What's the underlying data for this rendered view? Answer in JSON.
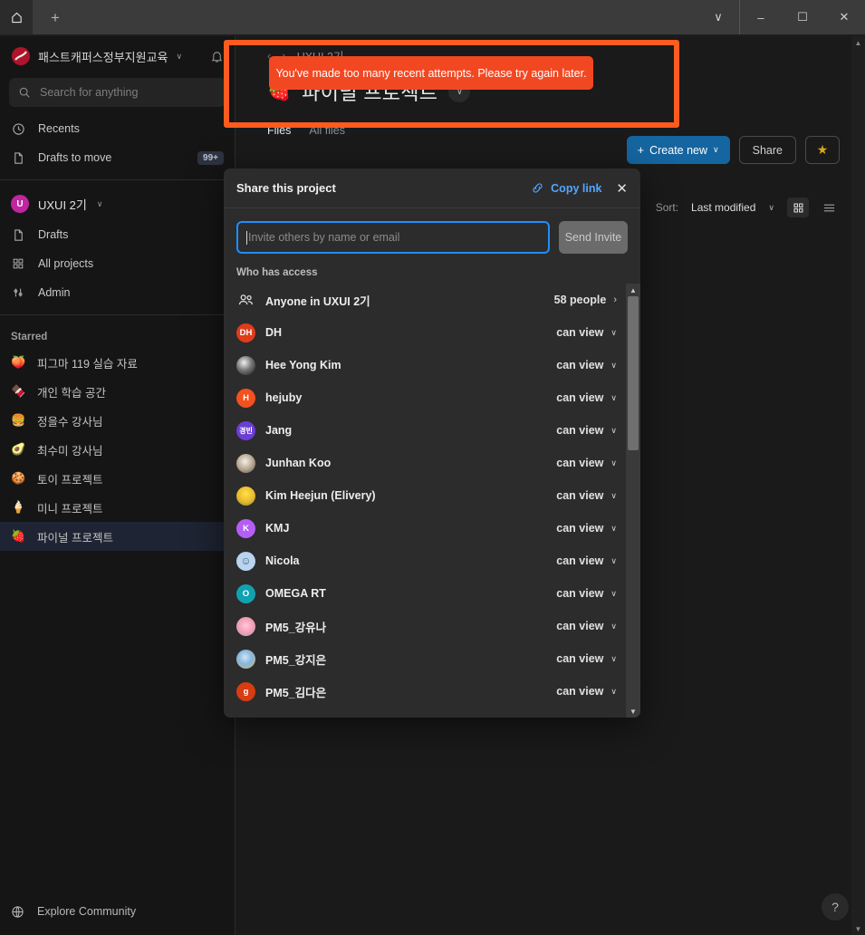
{
  "browser": {
    "home_icon": "home-icon",
    "new_tab_label": "+",
    "minimize_label": "–",
    "maximize_label": "☐",
    "close_label": "✕",
    "tab_list_label": "∨"
  },
  "sidebar": {
    "org_name": "패스트캐퍼스정부지원교육",
    "org_caret": "∨",
    "search": {
      "placeholder": "Search for anything"
    },
    "nav": [
      {
        "label": "Recents",
        "icon": "clock-icon",
        "badge": ""
      },
      {
        "label": "Drafts to move",
        "icon": "file-icon",
        "badge": "99+"
      }
    ],
    "team": {
      "name": "UXUI 2기",
      "initial": "U",
      "caret": "∨"
    },
    "team_nav": [
      {
        "label": "Drafts",
        "icon": "file-icon"
      },
      {
        "label": "All projects",
        "icon": "grid-icon"
      },
      {
        "label": "Admin",
        "icon": "sliders-icon"
      }
    ],
    "starred_label": "Starred",
    "starred": [
      {
        "emoji": "🍑",
        "label": "피그마 119 실습 자료",
        "active": false
      },
      {
        "emoji": "🍫",
        "label": "개인 학습 공간",
        "active": false
      },
      {
        "emoji": "🍔",
        "label": "정을수 강사님",
        "active": false
      },
      {
        "emoji": "🥑",
        "label": "최수미 강사님",
        "active": false
      },
      {
        "emoji": "🍪",
        "label": "토이 프로젝트",
        "active": false
      },
      {
        "emoji": "🍦",
        "label": "미니 프로젝트",
        "active": false
      },
      {
        "emoji": "🍓",
        "label": "파이널 프로젝트",
        "active": true
      }
    ],
    "explore": {
      "label": "Explore Community",
      "icon": "globe-icon"
    }
  },
  "main": {
    "breadcrumb": {
      "back": "‹",
      "forward": "›",
      "label": "UXUI 2기"
    },
    "project": {
      "emoji": "🍓",
      "title": "파이널 프로젝트",
      "caret": "∨"
    },
    "actions": {
      "create_new": "Create new",
      "create_plus": "+",
      "create_caret": "∨",
      "share": "Share",
      "star": "★"
    },
    "tabs": [
      {
        "label": "Files",
        "active": true
      },
      {
        "label": "All files",
        "active": false
      }
    ],
    "sort": {
      "label": "Sort:",
      "value": "Last modified",
      "caret": "∨"
    },
    "view": {
      "grid_icon": "grid-view-icon",
      "list_icon": "list-view-icon"
    },
    "help_button": "?"
  },
  "toast": {
    "message": "You've made too many recent attempts. Please try again later.",
    "bg_color": "#f24822",
    "highlight_color": "#ff5b1f"
  },
  "dialog": {
    "title": "Share this project",
    "copy_link": "Copy link",
    "copy_link_icon": "link-icon",
    "close_icon": "✕",
    "invite": {
      "placeholder": "Invite others by name or email",
      "value": "",
      "send_button": "Send Invite"
    },
    "who_has_access_label": "Who has access",
    "anyone_row": {
      "icon": "people-icon",
      "label": "Anyone in UXUI 2기",
      "count": "58 people",
      "chevron": "›"
    },
    "permission_default": "can view",
    "permission_caret": "∨",
    "members": [
      {
        "name": "DH",
        "initial": "DH",
        "avatar_color": "#e03c1a",
        "photo": false
      },
      {
        "name": "Hee Yong Kim",
        "initial": "",
        "avatar_color": "#8a8a8a",
        "photo": true,
        "perm": "can view"
      },
      {
        "name": "hejuby",
        "initial": "H",
        "avatar_color": "#f4511e",
        "photo": false,
        "perm": "can view"
      },
      {
        "name": "Jang",
        "initial": "경빈",
        "avatar_color": "#6b3fd4",
        "photo": false,
        "perm": "can view"
      },
      {
        "name": "Junhan Koo",
        "initial": "",
        "avatar_color": "#9e9287",
        "photo": true,
        "perm": "can view"
      },
      {
        "name": "Kim Heejun (Elivery)",
        "initial": "",
        "avatar_color": "#d9c24a",
        "photo": true,
        "perm": "can view"
      },
      {
        "name": "KMJ",
        "initial": "K",
        "avatar_color": "#b45ef7",
        "photo": false,
        "perm": "can view"
      },
      {
        "name": "Nicola",
        "initial": "☺",
        "avatar_color": "#b8d4ef",
        "photo": false,
        "perm": "can view"
      },
      {
        "name": "OMEGA RT",
        "initial": "O",
        "avatar_color": "#11a2b0",
        "photo": false,
        "perm": "can view"
      },
      {
        "name": "PM5_강유나",
        "initial": "",
        "avatar_color": "#e8a7bd",
        "photo": true,
        "perm": "can view"
      },
      {
        "name": "PM5_강지은",
        "initial": "",
        "avatar_color": "#8fb8d8",
        "photo": true,
        "perm": "can view"
      },
      {
        "name": "PM5_김다은",
        "initial": "g",
        "avatar_color": "#d83c12",
        "photo": false,
        "perm": "can view"
      }
    ]
  }
}
